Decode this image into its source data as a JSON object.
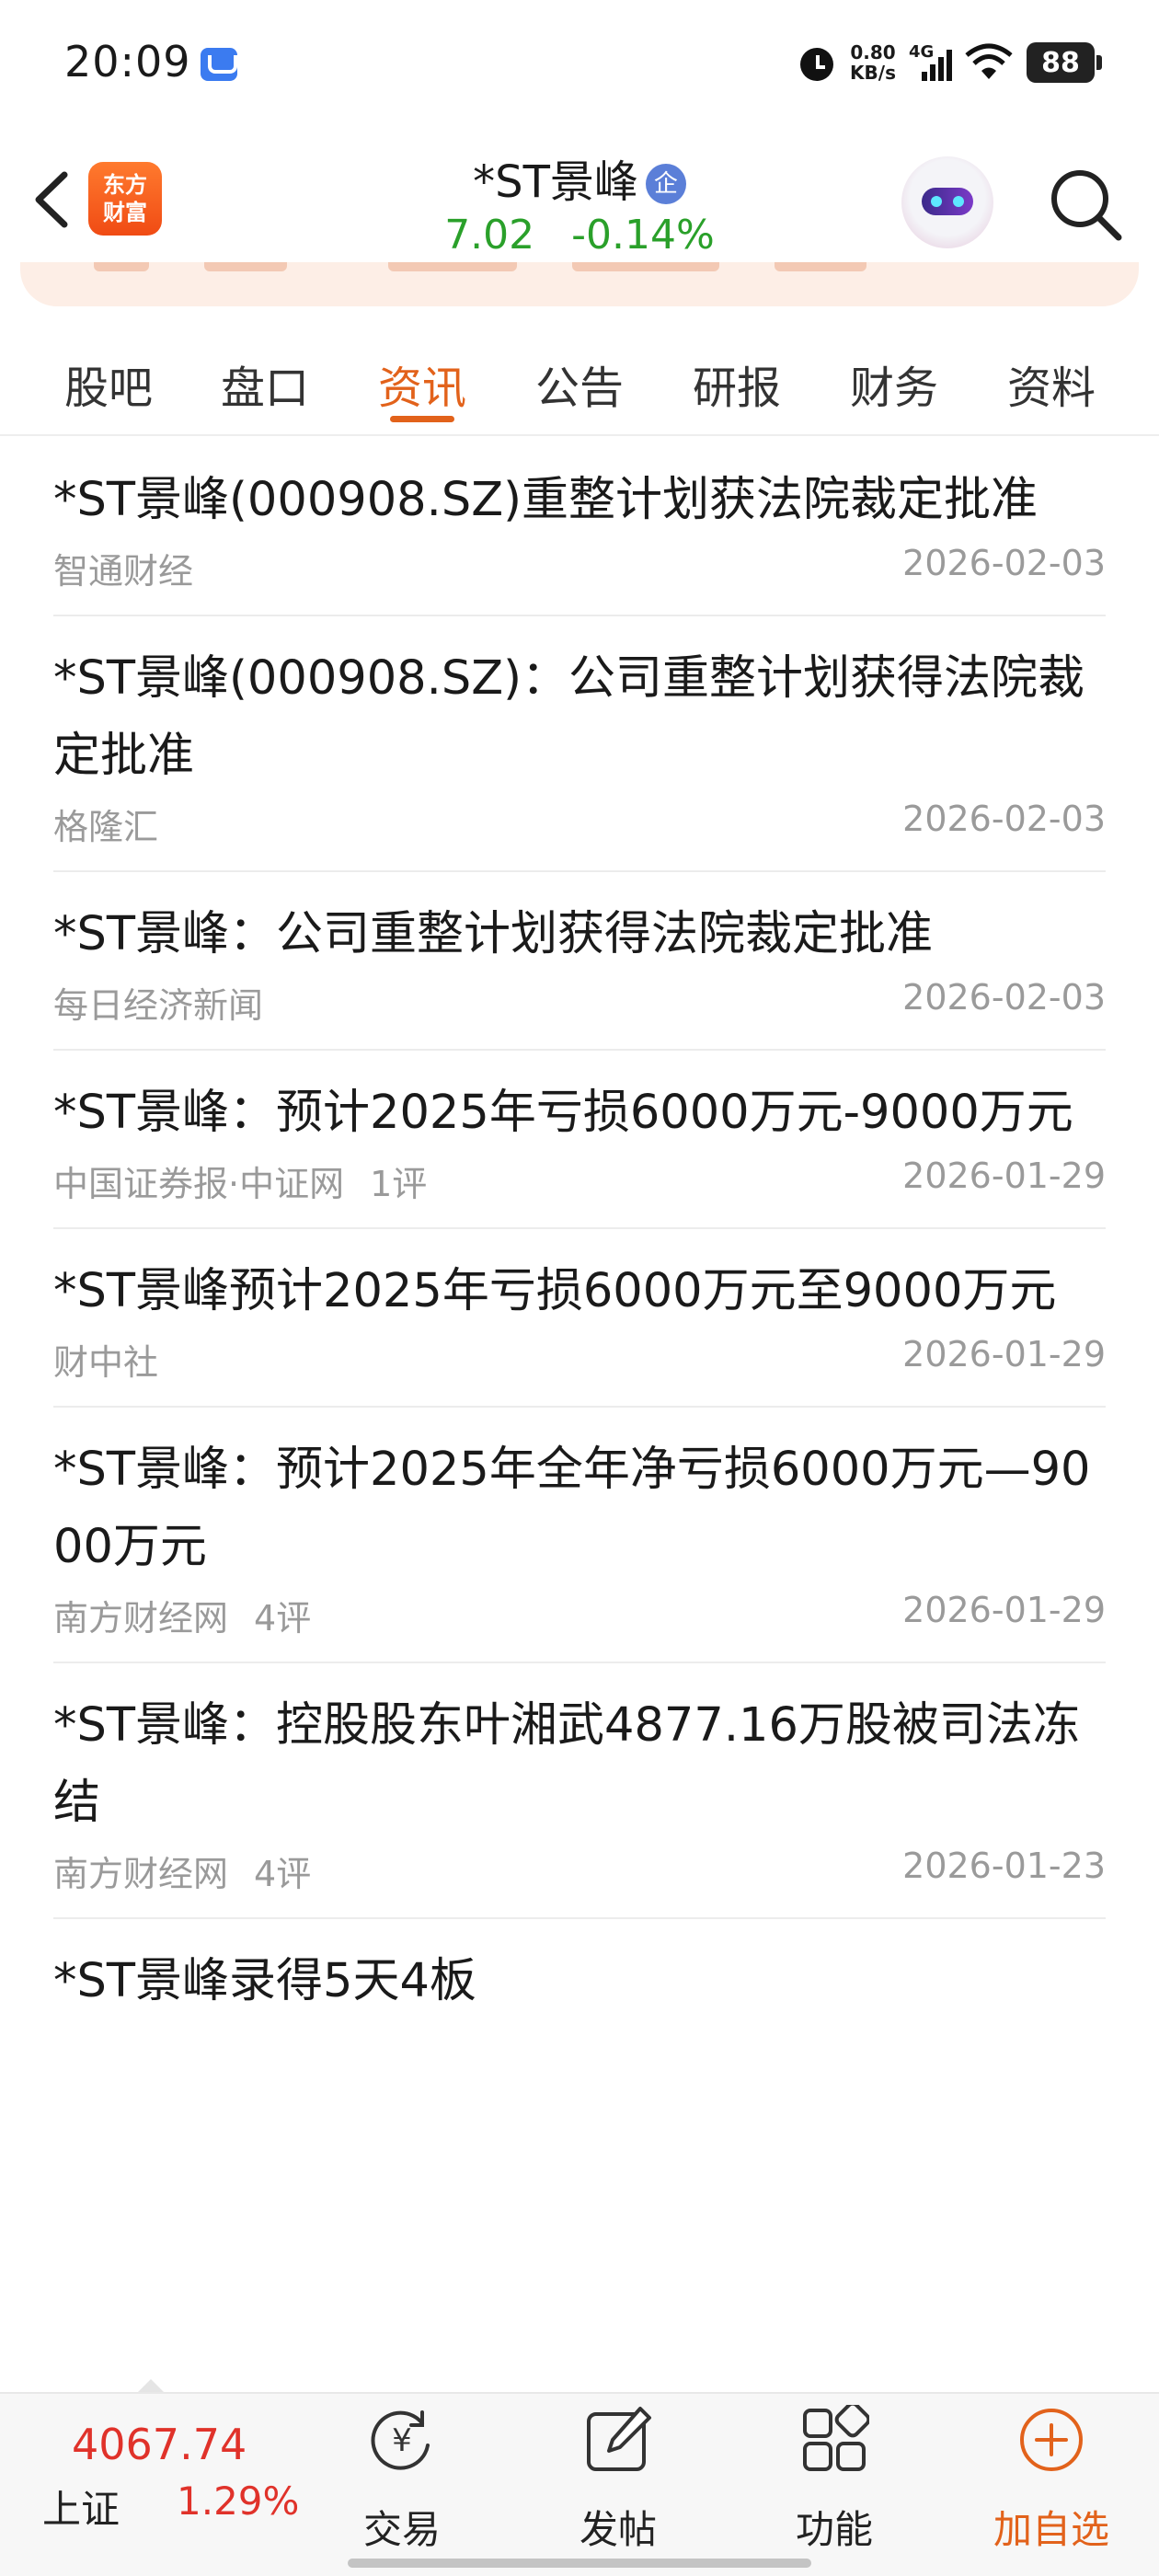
{
  "status_bar": {
    "time": "20:09",
    "net_speed_value": "0.80",
    "net_speed_unit": "KB/s",
    "network_type": "4G",
    "battery": "88"
  },
  "header": {
    "logo_line1": "东方",
    "logo_line2": "财富",
    "stock_name": "*ST景峰",
    "verified_badge": "企",
    "price": "7.02",
    "change_percent": "-0.14%",
    "price_color": "#2aa02a"
  },
  "tabs": [
    {
      "label": "股吧"
    },
    {
      "label": "盘口"
    },
    {
      "label": "资讯"
    },
    {
      "label": "公告"
    },
    {
      "label": "研报"
    },
    {
      "label": "财务"
    },
    {
      "label": "资料"
    }
  ],
  "active_tab": "资讯",
  "news": [
    {
      "title": "*ST景峰(000908.SZ)重整计划获法院裁定批准",
      "source": "智通财经",
      "comments": "",
      "date": "2026-02-03"
    },
    {
      "title": "*ST景峰(000908.SZ)：公司重整计划获得法院裁定批准",
      "source": "格隆汇",
      "comments": "",
      "date": "2026-02-03"
    },
    {
      "title": "*ST景峰：公司重整计划获得法院裁定批准",
      "source": "每日经济新闻",
      "comments": "",
      "date": "2026-02-03"
    },
    {
      "title": "*ST景峰：预计2025年亏损6000万元-9000万元",
      "source": "中国证券报·中证网",
      "comments": "1评",
      "date": "2026-01-29"
    },
    {
      "title": "*ST景峰预计2025年亏损6000万元至9000万元",
      "source": "财中社",
      "comments": "",
      "date": "2026-01-29"
    },
    {
      "title": "*ST景峰：预计2025年全年净亏损6000万元—9000万元",
      "source": "南方财经网",
      "comments": "4评",
      "date": "2026-01-29"
    },
    {
      "title": "*ST景峰：控股股东叶湘武4877.16万股被司法冻结",
      "source": "南方财经网",
      "comments": "4评",
      "date": "2026-01-23"
    },
    {
      "title": "*ST景峰录得5天4板",
      "source": "",
      "comments": "",
      "date": ""
    }
  ],
  "bottom_bar": {
    "index_value": "4067.74",
    "index_name": "上证",
    "index_change": "1.29%",
    "trade_label": "交易",
    "post_label": "发帖",
    "functions_label": "功能",
    "add_watchlist_label": "加自选",
    "accent_color": "#e2621b",
    "up_color": "#e0322a"
  }
}
